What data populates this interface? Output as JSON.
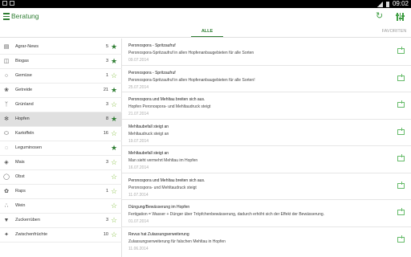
{
  "status_bar": {
    "time": "09:02"
  },
  "app_bar": {
    "title": "Beratung"
  },
  "tabs": [
    {
      "label": "ALLE",
      "active": true
    },
    {
      "label": "FAVORITEN",
      "active": false
    }
  ],
  "categories": [
    {
      "label": "Agrar-News",
      "count": "5",
      "favorite": true,
      "icon": "newspaper-icon"
    },
    {
      "label": "Biogas",
      "count": "3",
      "favorite": true,
      "icon": "biogas-icon"
    },
    {
      "label": "Gemüse",
      "count": "1",
      "favorite": false,
      "icon": "vegetable-icon"
    },
    {
      "label": "Getreide",
      "count": "21",
      "favorite": true,
      "icon": "grain-icon"
    },
    {
      "label": "Grünland",
      "count": "3",
      "favorite": false,
      "icon": "grassland-icon"
    },
    {
      "label": "Hopfen",
      "count": "8",
      "favorite": true,
      "icon": "hop-icon",
      "selected": true
    },
    {
      "label": "Kartoffeln",
      "count": "16",
      "favorite": false,
      "icon": "potato-icon"
    },
    {
      "label": "Leguminosen",
      "count": "",
      "favorite": true,
      "icon": "legume-icon"
    },
    {
      "label": "Mais",
      "count": "3",
      "favorite": false,
      "icon": "corn-icon"
    },
    {
      "label": "Obst",
      "count": "",
      "favorite": false,
      "icon": "fruit-icon"
    },
    {
      "label": "Raps",
      "count": "1",
      "favorite": false,
      "icon": "rapeseed-icon"
    },
    {
      "label": "Wein",
      "count": "",
      "favorite": false,
      "icon": "grape-icon"
    },
    {
      "label": "Zuckerrüben",
      "count": "3",
      "favorite": false,
      "icon": "sugarbeet-icon"
    },
    {
      "label": "Zwischenfrüchte",
      "count": "10",
      "favorite": false,
      "icon": "cover-crop-icon"
    }
  ],
  "news": [
    {
      "title": "Peronospora - Spritzaufruf",
      "subtitle": "Peronospora-Spritzaufruf in allen Hopfenanbaugebieten für alle Sorten",
      "date": "09.07.2014"
    },
    {
      "title": "Peronospora - Spritzaufruf",
      "subtitle": "Peronospora-Spritzaufruf in allen Hopfenanbaugebieten für alle Sorten!",
      "date": "25.07.2014"
    },
    {
      "title": "Peronospora und Mehltau breiten sich aus.",
      "subtitle": "Hopfen Peronospora- und Mehltaudruck steigt",
      "date": "21.07.2014"
    },
    {
      "title": "Mehltaubefall steigt an",
      "subtitle": "Mehltaudruck steigt an",
      "date": "19.07.2014"
    },
    {
      "title": "Mehltaubefall steigt an",
      "subtitle": "Man sieht vermehrt Mehltau im Hopfen",
      "date": "16.07.2014"
    },
    {
      "title": "Peronospora und Mehltau breiten sich aus.",
      "subtitle": "Peronospora- und Mehltaudruck steigt",
      "date": "11.07.2014"
    },
    {
      "title": "Düngung/Bewässerung im Hopfen",
      "subtitle": "Fertigation = Wasser + Dünger über Tröpfchenbewässerung, dadurch erhöht sich der Effekt der Bewässerung.",
      "date": "01.07.2014"
    },
    {
      "title": "Revus hat Zulassungserweiterung",
      "subtitle": "Zulassungserweiterung für falschen Mehltau in Hopfen",
      "date": "11.06.2014"
    }
  ],
  "colors": {
    "accent": "#2e7d32",
    "accent_light": "#8bc34a",
    "selected_row": "#e0e0e0"
  }
}
